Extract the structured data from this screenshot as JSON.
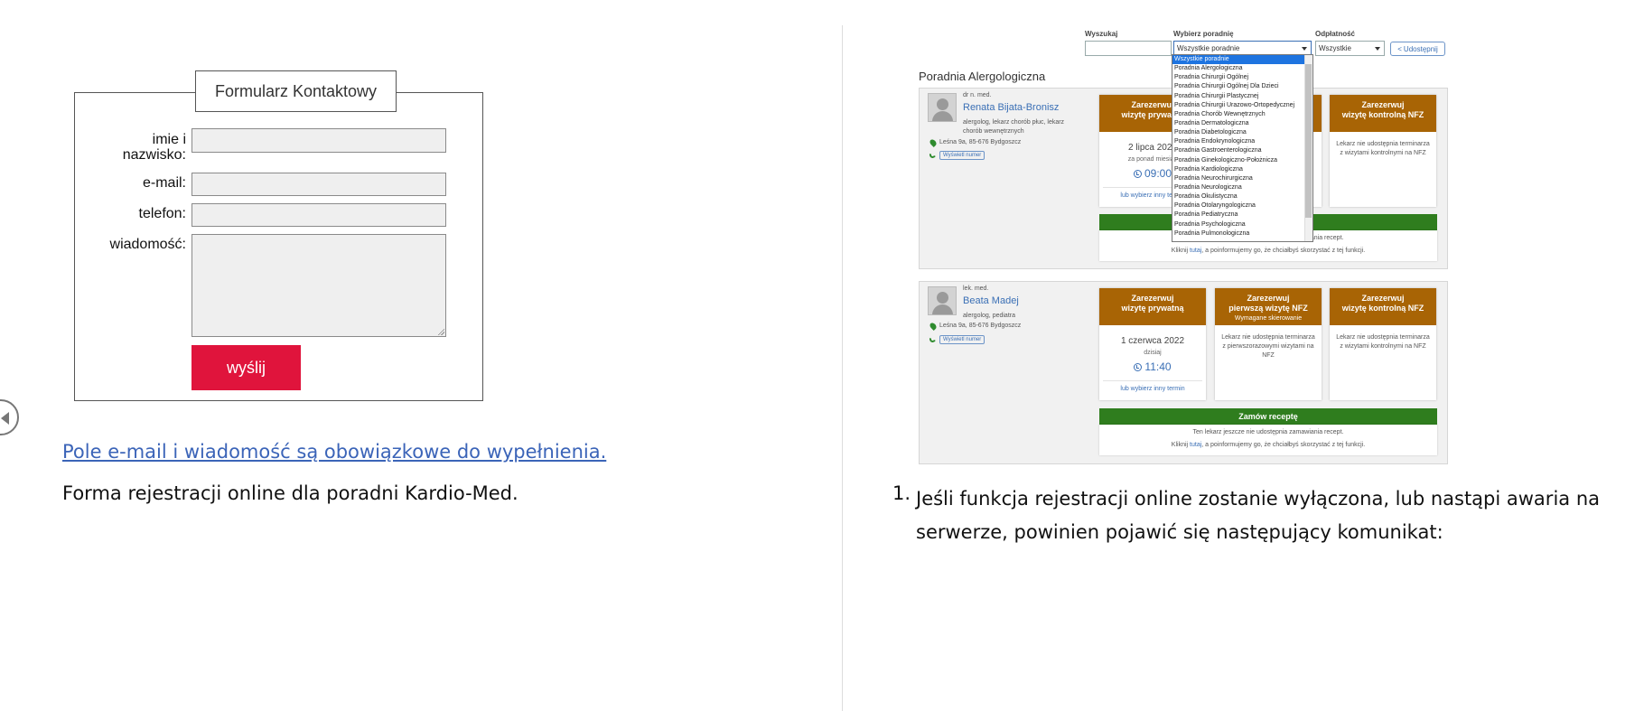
{
  "contact_form": {
    "title": "Formularz Kontaktowy",
    "fields": [
      {
        "label": "imie i nazwisko:"
      },
      {
        "label": "e-mail:"
      },
      {
        "label": "telefon:"
      },
      {
        "label": "wiadomość:"
      }
    ],
    "submit_label": "wyślij"
  },
  "left_page": {
    "link_text": "Pole e-mail i wiadomość są obowiązkowe do wypełnienia.",
    "caption": "Forma rejestracji online dla poradni Kardio-Med."
  },
  "registration": {
    "search_label": "Wyszukaj",
    "clinic_label": "Wybierz poradnię",
    "clinic_value": "Wszystkie poradnie",
    "payment_label": "Odpłatność",
    "payment_value": "Wszystkie",
    "share_label": "Udostępnij",
    "section_title": "Poradnia Alergologiczna",
    "dropdown_options": [
      "Wszystkie poradnie",
      "Poradnia Alergologiczna",
      "Poradnia Chirurgii Ogólnej",
      "Poradnia Chirurgii Ogólnej Dla Dzieci",
      "Poradnia Chirurgii Plastycznej",
      "Poradnia Chirurgii Urazowo-Ortopedycznej",
      "Poradnia Chorób Wewnętrznych",
      "Poradnia Dermatologiczna",
      "Poradnia Diabetologiczna",
      "Poradnia Endokrynologiczna",
      "Poradnia Gastroenterologiczna",
      "Poradnia Ginekologiczno-Położnicza",
      "Poradnia Kardiologiczna",
      "Poradnia Neurochirurgiczna",
      "Poradnia Neurologiczna",
      "Poradnia Okulistyczna",
      "Poradnia Otolaryngologiczna",
      "Poradnia Pediatryczna",
      "Poradnia Psychologiczna",
      "Poradnia Pulmonologiczna"
    ],
    "doctors": [
      {
        "title": "dr n. med.",
        "name": "Renata Bijata-Bronisz",
        "spec_line1": "alergolog, lekarz chorób płuc, lekarz",
        "spec_line2": "chorób wewnętrznych",
        "address": "Leśna 9a, 85-676 Bydgoszcz",
        "show_number": "Wyświetl numer",
        "private_head1": "Zarezerwuj",
        "private_head2": "wizytę prywatną",
        "date": "2 lipca 2022",
        "relative": "za ponad miesiąc",
        "time": "09:00",
        "other_term": "lub wybierz inny termin",
        "control_head1": "Zarezerwuj",
        "control_head2": "wizytę kontrolną NFZ",
        "control_note": "Lekarz nie udostępnia terminarza z wizytami kontrolnymi na NFZ",
        "rx_note": "Ten lekarz jeszcze nie udostępnia zamawiania recept.",
        "rx_click_pre": "Kliknij",
        "rx_click_link": "tutaj",
        "rx_click_post": ", a poinformujemy go, że chciałbyś skorzystać z tej funkcji."
      },
      {
        "title": "lek. med.",
        "name": "Beata Madej",
        "spec_line1": "alergolog, pediatra",
        "address": "Leśna 9a, 85-676 Bydgoszcz",
        "show_number": "Wyświetl numer",
        "private_head1": "Zarezerwuj",
        "private_head2": "wizytę prywatną",
        "date": "1 czerwca 2022",
        "relative": "dzisiaj",
        "time": "11:40",
        "other_term": "lub wybierz inny termin",
        "first_head1": "Zarezerwuj",
        "first_head2": "pierwszą wizytę NFZ",
        "first_sub": "Wymagane skierowanie",
        "first_note": "Lekarz nie udostępnia terminarza z pierwszorazowymi wizytami na NFZ",
        "control_head1": "Zarezerwuj",
        "control_head2": "wizytę kontrolną NFZ",
        "control_note": "Lekarz nie udostępnia terminarza z wizytami kontrolnymi na NFZ",
        "rx_label": "Zamów receptę",
        "rx_note": "Ten lekarz jeszcze nie udostępnia zamawiania recept.",
        "rx_click_pre": "Kliknij",
        "rx_click_link": "tutaj",
        "rx_click_post": ", a poinformujemy go, że chciałbyś skorzystać z tej funkcji."
      }
    ]
  },
  "right_page": {
    "list_number": "1.",
    "list_text": "Jeśli funkcja rejestracji online zostanie wyłączona, lub nastąpi awaria na serwerze, powinien pojawić się następujący komunikat:"
  },
  "colors": {
    "submit": "#e0143c",
    "link": "#3b64b8",
    "slot_header": "#a86405",
    "rx_bar": "#2f7d1e",
    "dropdown_selected": "#1e74e0"
  }
}
